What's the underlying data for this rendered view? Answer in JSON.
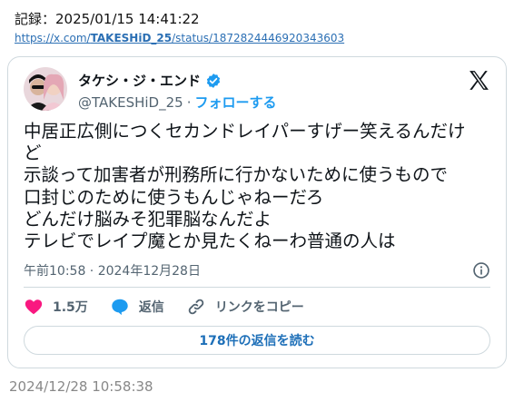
{
  "header": {
    "record_label": "記録：2025/01/15 14:41:22",
    "url_prefix": "https://x.com/",
    "url_user": "TAKESHiD_25",
    "url_suffix": "/status/1872824446920343603"
  },
  "tweet": {
    "display_name": "タケシ・ジ・エンド",
    "handle": "@TAKESHiD_25",
    "separator": "·",
    "follow_label": "フォローする",
    "text_lines": [
      "中居正広側につくセカンドレイパーすげー笑えるんだけ",
      "ど",
      "示談って加害者が刑務所に行かないために使うもので",
      "口封じのために使うもんじゃねーだろ",
      "どんだけ脳みそ犯罪脳なんだよ",
      "テレビでレイプ魔とか見たくねーわ普通の人は"
    ],
    "timestamp": "午前10:58 · 2024年12月28日",
    "likes": "1.5万",
    "reply_label": "返信",
    "copy_link_label": "リンクをコピー",
    "read_replies_label": "178件の返信を読む"
  },
  "footer": {
    "date": "2024/12/28 10:58:38"
  },
  "colors": {
    "accent": "#1d9bf0",
    "heart": "#f91880",
    "muted": "#536471",
    "border": "#cfd9de"
  },
  "icons": [
    "avatar",
    "verified-badge-icon",
    "x-logo-icon",
    "info-icon",
    "heart-icon",
    "reply-bubble-icon",
    "link-icon"
  ]
}
